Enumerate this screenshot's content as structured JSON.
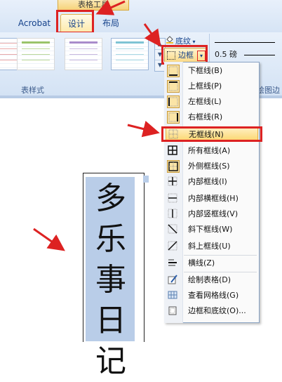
{
  "ribbon": {
    "context_tab_title": "表格工具",
    "tabs": [
      {
        "label": "Acrobat"
      },
      {
        "label": "设计"
      },
      {
        "label": "布局"
      }
    ],
    "group_label": "表样式",
    "group_label_right": "绘图边",
    "shading_label": "底纹",
    "border_label": "边框",
    "pen_weight": "0.5 磅"
  },
  "document": {
    "text": "多乐事日记"
  },
  "border_menu": {
    "items": [
      {
        "label": "下框线(B)",
        "icon": "bottom-border-icon"
      },
      {
        "label": "上框线(P)",
        "icon": "top-border-icon"
      },
      {
        "label": "左框线(L)",
        "icon": "left-border-icon"
      },
      {
        "label": "右框线(R)",
        "icon": "right-border-icon"
      },
      {
        "label": "无框线(N)",
        "icon": "no-border-icon",
        "selected": true
      },
      {
        "label": "所有框线(A)",
        "icon": "all-borders-icon"
      },
      {
        "label": "外侧框线(S)",
        "icon": "outside-borders-icon"
      },
      {
        "label": "内部框线(I)",
        "icon": "inside-borders-icon"
      },
      {
        "label": "内部横框线(H)",
        "icon": "inside-horizontal-border-icon"
      },
      {
        "label": "内部竖框线(V)",
        "icon": "inside-vertical-border-icon"
      },
      {
        "label": "斜下框线(W)",
        "icon": "diagonal-down-border-icon"
      },
      {
        "label": "斜上框线(U)",
        "icon": "diagonal-up-border-icon"
      },
      {
        "label": "横线(Z)",
        "icon": "horizontal-line-icon"
      },
      {
        "label": "绘制表格(D)",
        "icon": "draw-table-icon"
      },
      {
        "label": "查看网格线(G)",
        "icon": "view-gridlines-icon"
      },
      {
        "label": "边框和底纹(O)...",
        "icon": "borders-shading-icon"
      }
    ]
  },
  "colors": {
    "highlight": "#dd2222",
    "selection": "#b9cde8"
  }
}
